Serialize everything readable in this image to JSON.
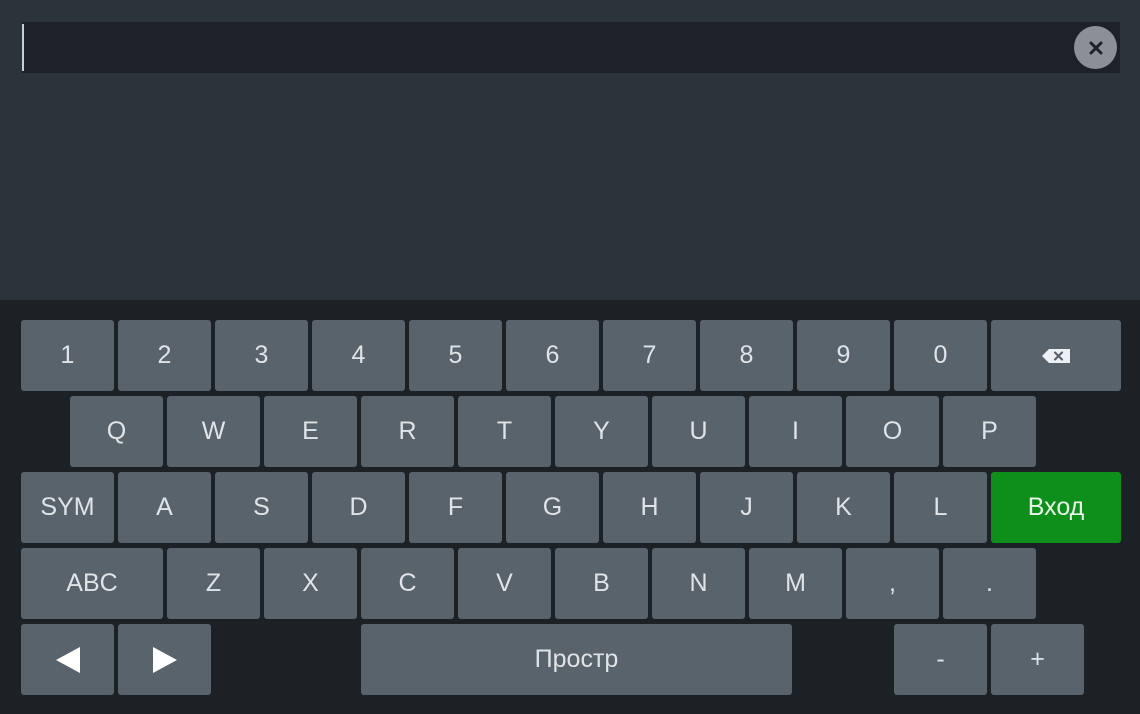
{
  "input": {
    "value": "",
    "clear_icon": "close-icon"
  },
  "keyboard": {
    "row1": [
      "1",
      "2",
      "3",
      "4",
      "5",
      "6",
      "7",
      "8",
      "9",
      "0"
    ],
    "backspace_icon": "backspace-icon",
    "row2": [
      "Q",
      "W",
      "E",
      "R",
      "T",
      "Y",
      "U",
      "I",
      "O",
      "P"
    ],
    "sym_label": "SYM",
    "row3": [
      "A",
      "S",
      "D",
      "F",
      "G",
      "H",
      "J",
      "K",
      "L"
    ],
    "enter_label": "Вход",
    "enter_color": "#0e8f1c",
    "abc_label": "ABC",
    "row4": [
      "Z",
      "X",
      "C",
      "V",
      "B",
      "N",
      "M",
      ",",
      "."
    ],
    "left_arrow_icon": "left-arrow-icon",
    "right_arrow_icon": "right-arrow-icon",
    "space_label": "Простр",
    "minus_label": "-",
    "plus_label": "+"
  }
}
